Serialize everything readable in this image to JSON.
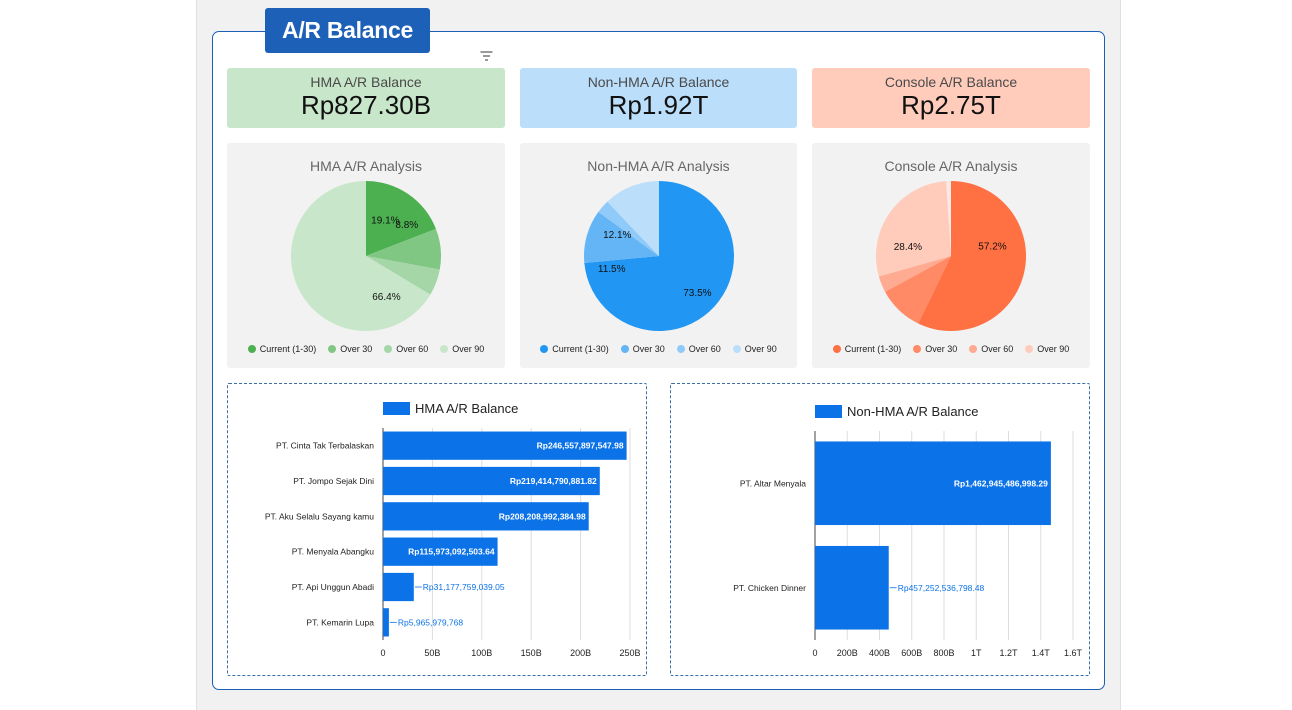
{
  "page": {
    "title": "A/R Balance"
  },
  "kpis": [
    {
      "label": "HMA A/R Balance",
      "value": "Rp827.30B",
      "color": "#c8e6c9"
    },
    {
      "label": "Non-HMA A/R Balance",
      "value": "Rp1.92T",
      "color": "#bbdefb"
    },
    {
      "label": "Console A/R Balance",
      "value": "Rp2.75T",
      "color": "#ffccbc"
    }
  ],
  "chart_data": [
    {
      "type": "pie",
      "title": "HMA A/R Analysis",
      "categories": [
        "Current (1-30)",
        "Over 30",
        "Over 60",
        "Over 90"
      ],
      "values": [
        19.1,
        8.8,
        5.7,
        66.4
      ],
      "labels": [
        "19.1%",
        "8.8%",
        "",
        "66.4%"
      ],
      "colors": [
        "#4caf50",
        "#81c784",
        "#a5d6a7",
        "#c8e6c9"
      ],
      "legend": "bottom"
    },
    {
      "type": "pie",
      "title": "Non-HMA A/R Analysis",
      "categories": [
        "Current (1-30)",
        "Over 30",
        "Over 60",
        "Over 90"
      ],
      "values": [
        73.5,
        11.5,
        2.9,
        12.1
      ],
      "labels": [
        "73.5%",
        "11.5%",
        "",
        "12.1%"
      ],
      "colors": [
        "#2196f3",
        "#64b5f6",
        "#90caf9",
        "#bbdefb"
      ],
      "legend": "bottom"
    },
    {
      "type": "pie",
      "title": "Console A/R Analysis",
      "categories": [
        "Current (1-30)",
        "Over 30",
        "Over 60",
        "Over 90"
      ],
      "values": [
        57.2,
        9.9,
        3.5,
        28.4,
        1.0
      ],
      "labels": [
        "57.2%",
        "",
        "",
        "28.4%",
        ""
      ],
      "colors": [
        "#ff7043",
        "#ff8a65",
        "#ffab91",
        "#ffccbc",
        "#fbe9e7"
      ],
      "legend": "bottom"
    },
    {
      "type": "bar",
      "orientation": "horizontal",
      "series": [
        {
          "name": "HMA A/R Balance",
          "values": [
            246.557897547,
            219.414790881,
            208.208992384,
            115.973092503,
            31.177759039,
            5.965979768
          ]
        }
      ],
      "categories": [
        "PT. Cinta Tak Terbalaskan",
        "PT. Jompo Sejak Dini",
        "PT. Aku Selalu Sayang kamu",
        "PT. Menyala Abangku",
        "PT. Api Unggun Abadi",
        "PT. Kemarin Lupa"
      ],
      "data_labels": [
        "Rp246,557,897,547.98",
        "Rp219,414,790,881.82",
        "Rp208,208,992,384.98",
        "Rp115,973,092,503.64",
        "Rp31,177,759,039.05",
        "Rp5,965,979,768"
      ],
      "value_unit": "B",
      "xlim": [
        0,
        250
      ],
      "xticks": [
        "0",
        "50B",
        "100B",
        "150B",
        "200B",
        "250B"
      ],
      "grid": true,
      "color": "#0b72e8",
      "legend": "top"
    },
    {
      "type": "bar",
      "orientation": "horizontal",
      "series": [
        {
          "name": "Non-HMA A/R Balance",
          "values": [
            1462.945486998,
            457.252536798
          ]
        }
      ],
      "categories": [
        "PT. Altar Menyala",
        "PT. Chicken Dinner"
      ],
      "data_labels": [
        "Rp1,462,945,486,998.29",
        "Rp457,252,536,798.48"
      ],
      "value_unit": "B",
      "xlim": [
        0,
        1600
      ],
      "xticks": [
        "0",
        "200B",
        "400B",
        "600B",
        "800B",
        "1T",
        "1.2T",
        "1.4T",
        "1.6T"
      ],
      "grid": true,
      "color": "#0b72e8",
      "legend": "top"
    }
  ]
}
